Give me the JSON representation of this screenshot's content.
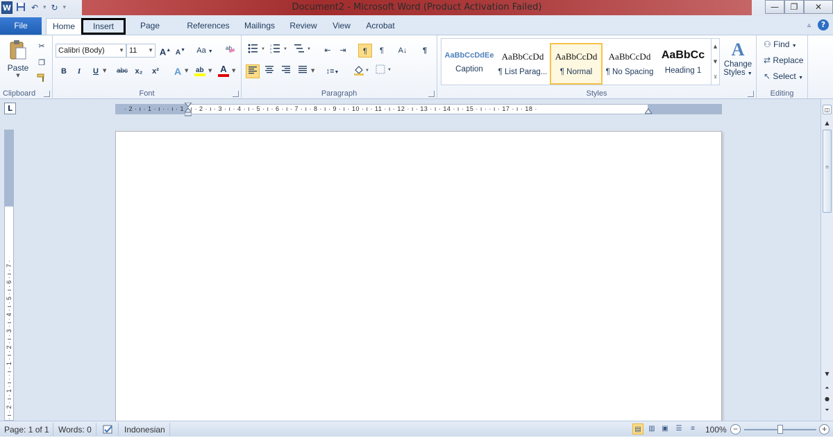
{
  "title_bar": {
    "title": "Document2 - Microsoft Word (Product Activation Failed)",
    "app_logo": "W",
    "qat": {
      "save_icon": "floppy-disk",
      "undo_icon": "undo-arrow",
      "redo_icon": "redo-arrow"
    },
    "window_buttons": {
      "minimize": "—",
      "restore": "❐",
      "close": "✕"
    }
  },
  "tabs": {
    "file": "File",
    "items": [
      "Home",
      "Insert",
      "Page Layout",
      "References",
      "Mailings",
      "Review",
      "View",
      "Acrobat"
    ],
    "active": "Home",
    "highlighted": "Insert"
  },
  "ribbon": {
    "clipboard": {
      "label": "Clipboard",
      "paste": "Paste",
      "cut_icon": "scissors",
      "copy_icon": "copy",
      "format_painter_icon": "paintbrush"
    },
    "font": {
      "label": "Font",
      "font_name": "Calibri (Body)",
      "font_size": "11",
      "grow": "A",
      "shrink": "A",
      "change_case": "Aa",
      "bold": "B",
      "italic": "I",
      "underline": "U",
      "strike": "abc",
      "subscript": "x₂",
      "superscript": "x²",
      "font_color": "A"
    },
    "paragraph": {
      "label": "Paragraph",
      "pilcrow": "¶"
    },
    "styles": {
      "label": "Styles",
      "items": [
        {
          "sample": "AaBbCcDdEe",
          "name": "Caption"
        },
        {
          "sample": "AaBbCcDd",
          "name": "¶ List Parag..."
        },
        {
          "sample": "AaBbCcDd",
          "name": "¶ Normal"
        },
        {
          "sample": "AaBbCcDd",
          "name": "¶ No Spacing"
        },
        {
          "sample": "AaBbCc",
          "name": "Heading 1"
        }
      ],
      "selected_index": 2,
      "change_styles_line1": "Change",
      "change_styles_line2": "Styles"
    },
    "editing": {
      "label": "Editing",
      "find": "Find",
      "replace": "Replace",
      "select": "Select"
    }
  },
  "ruler": {
    "tab_selector": "L",
    "h_ticks": "· 2 · ı · 1 · ı ·  · ı · 1 · ı · 2 · ı · 3 · ı · 4 · ı · 5 · ı · 6 · ı · 7 · ı · 8 · ı · 9 · ı · 10 · ı · 11 · ı · 12 · ı · 13 · ı · 14 · ı · 15 · ı ·  · ı · 17 · ı · 18 ·",
    "v_ticks": "· ı · 2 · ı · 1 · ı ·   · ı · 1 · ı · 2 · ı · 3 · ı · 4 · ı · 5 · ı · 6 · ı · 7 ·"
  },
  "status_bar": {
    "page": "Page: 1 of 1",
    "words": "Words: 0",
    "language": "Indonesian",
    "zoom": "100%"
  }
}
